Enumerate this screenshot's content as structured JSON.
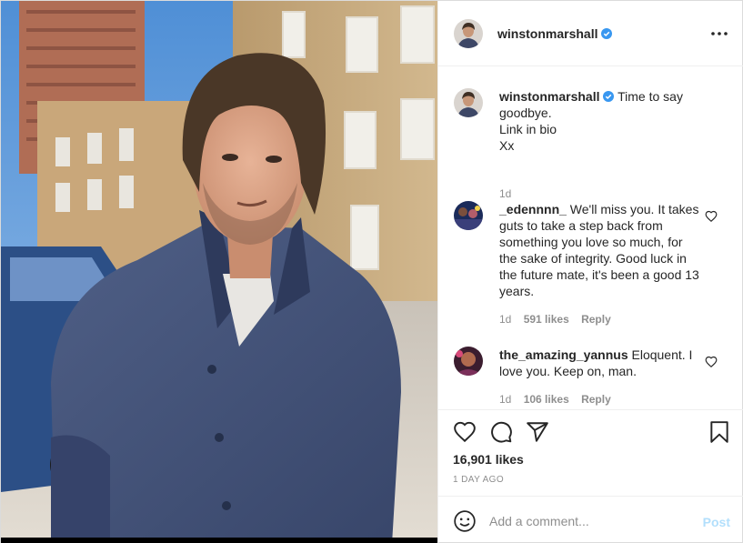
{
  "post": {
    "author": {
      "username": "winstonmarshall",
      "verified_icon": "verified-badge-icon",
      "avatar": "profile-avatar"
    },
    "photo": {
      "description_icon": "post-photo"
    },
    "comments": [
      {
        "username": "winstonmarshall",
        "text": "Time to say goodbye.",
        "lines": [
          "Link in bio",
          "Xx"
        ],
        "time": "1d",
        "is_caption": true
      },
      {
        "username": "_edennnn_",
        "text": "We'll miss you. It takes guts to take a step back from something you love so much, for the sake of integrity. Good luck in the future mate, it's been a good 13 years.",
        "time": "1d",
        "likes": "591 likes",
        "reply": "Reply"
      },
      {
        "username": "the_amazing_yannus",
        "text": "Eloquent. I love you. Keep on, man.",
        "time": "1d",
        "likes": "106 likes",
        "reply": "Reply"
      }
    ],
    "actions": {
      "icons": [
        "heart-icon",
        "comment-icon",
        "share-icon",
        "bookmark-icon"
      ]
    },
    "likes": "16,901 likes",
    "time_ago": "1 DAY AGO",
    "add_comment": {
      "placeholder": "Add a comment...",
      "post_label": "Post"
    }
  },
  "colors": {
    "text": "#262626",
    "muted": "#8e8e8e",
    "verified_blue": "#3897f0",
    "post_button_disabled": "#b2dffc",
    "border": "#efefef"
  }
}
